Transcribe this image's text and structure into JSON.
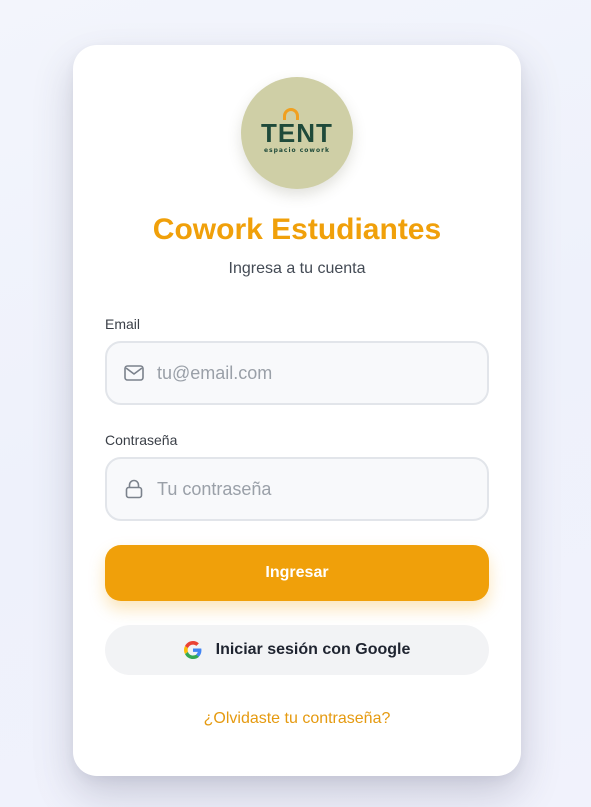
{
  "logo": {
    "word": "TENT",
    "sub": "espacio cowork"
  },
  "header": {
    "title": "Cowork Estudiantes",
    "subtitle": "Ingresa a tu cuenta"
  },
  "form": {
    "email": {
      "label": "Email",
      "placeholder": "tu@email.com",
      "value": "",
      "icon": "mail-icon"
    },
    "password": {
      "label": "Contraseña",
      "placeholder": "Tu contraseña",
      "value": "",
      "icon": "lock-icon"
    },
    "submit_label": "Ingresar",
    "google_label": "Iniciar sesión con Google",
    "forgot_label": "¿Olvidaste tu contraseña?"
  },
  "colors": {
    "accent": "#f0a00a",
    "logo_bg": "#cfcfa6",
    "logo_text": "#1f4a3a",
    "field_bg": "#f8f9fb",
    "google_btn_bg": "#f2f3f5"
  }
}
